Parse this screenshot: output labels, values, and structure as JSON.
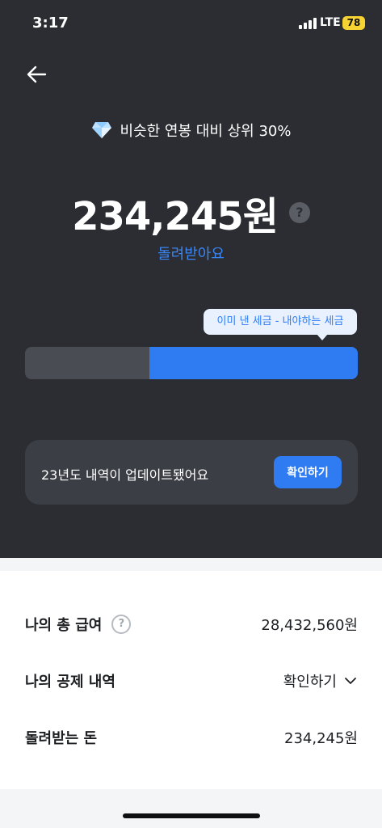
{
  "status": {
    "time": "3:17",
    "network": "LTE",
    "battery": "78"
  },
  "header": {
    "rank_text": "비슷한 연봉 대비 상위 30%"
  },
  "summary": {
    "amount": "234,245원",
    "help": "?",
    "label": "돌려받아요",
    "tooltip": "이미 낸 세금 - 내야하는 세금",
    "bar_fraction_paid": 0.627
  },
  "notice": {
    "text": "23년도 내역이 업데이트됐어요",
    "button": "확인하기"
  },
  "details": {
    "salary_label": "나의 총 급여",
    "salary_help": "?",
    "salary_value": "28,432,560원",
    "deduction_label": "나의 공제 내역",
    "deduction_value": "확인하기",
    "refund_label": "돌려받는 돈",
    "refund_value": "234,245원"
  },
  "colors": {
    "accent": "#2f7cf2",
    "background_dark": "#2b2d32"
  }
}
